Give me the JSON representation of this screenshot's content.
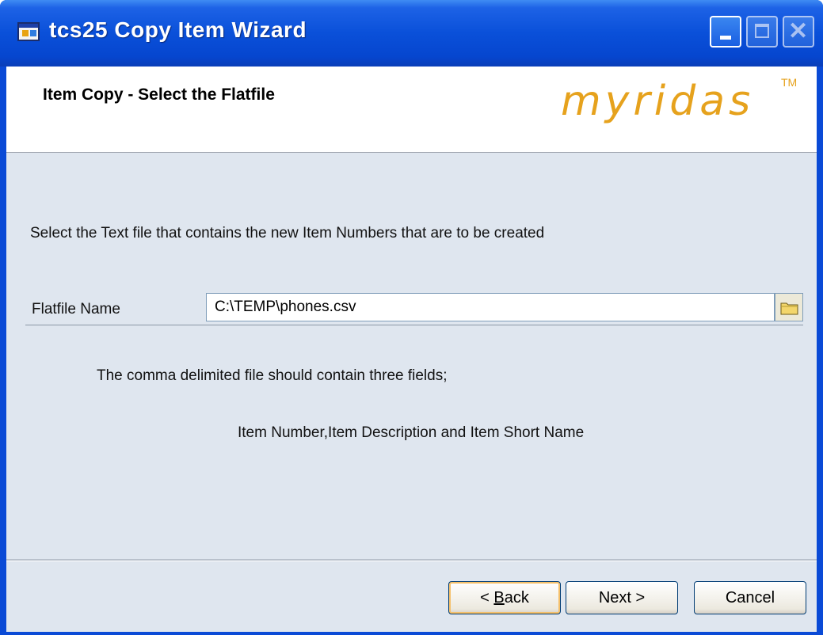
{
  "window": {
    "title": "tcs25 Copy Item Wizard"
  },
  "header": {
    "title": "Item Copy - Select the Flatfile",
    "logo_text": "myridas",
    "logo_tm": "TM",
    "logo_color": "#e6a21d"
  },
  "body": {
    "instruction": "Select the Text file that contains the new Item Numbers that are to be created",
    "flatfile_label": "Flatfile Name",
    "flatfile_value": "C:\\TEMP\\phones.csv",
    "note_line1": "The comma delimited file should contain three fields;",
    "note_line2": "Item Number,Item Description and Item Short Name"
  },
  "buttons": {
    "back_prefix": "< ",
    "back_mnemonic": "B",
    "back_rest": "ack",
    "next": "Next >",
    "cancel": "Cancel"
  },
  "icons": [
    "app-icon",
    "minimize-icon",
    "maximize-icon",
    "close-icon",
    "folder-icon"
  ]
}
